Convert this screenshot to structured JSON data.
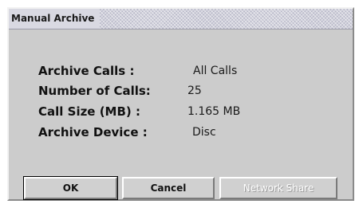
{
  "dialog": {
    "title": "Manual Archive"
  },
  "info": [
    {
      "label": "Archive Calls :",
      "value": "All Calls"
    },
    {
      "label": "Number of Calls:",
      "value": "25"
    },
    {
      "label": "Call Size (MB) :",
      "value": "1.165 MB"
    },
    {
      "label": "Archive Device :",
      "value": "Disc"
    }
  ],
  "buttons": {
    "ok": "OK",
    "cancel": "Cancel",
    "network_share": "Network Share"
  },
  "colors": {
    "dialog_background": "#cccccc",
    "disabled_text": "#ffffff"
  }
}
